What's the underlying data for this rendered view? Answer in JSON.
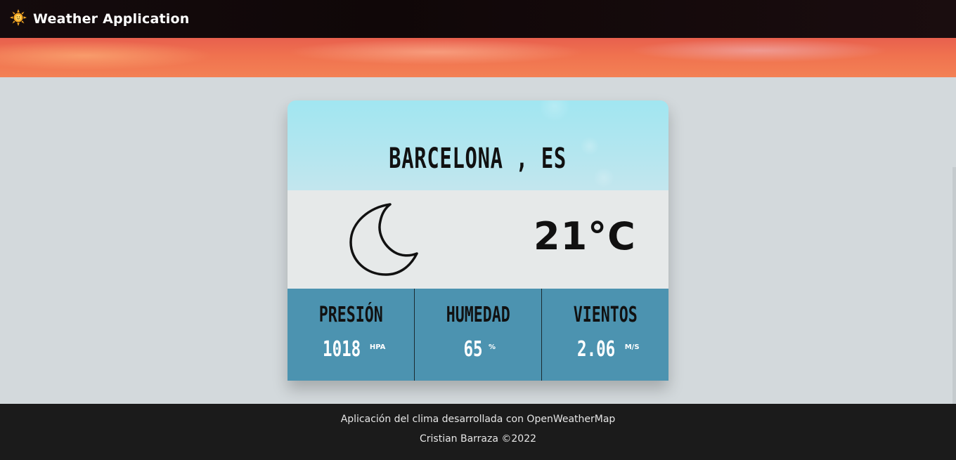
{
  "navbar": {
    "title": "Weather Application",
    "logo_icon": "sun-icon"
  },
  "weather": {
    "city": "BARCELONA , ES",
    "temperature": "21°C",
    "condition_icon": "moon-icon",
    "stats": [
      {
        "label": "PRESIÓN",
        "value": "1018",
        "unit": "HPA"
      },
      {
        "label": "HUMEDAD",
        "value": "65",
        "unit": "%"
      },
      {
        "label": "VIENTOS",
        "value": "2.06",
        "unit": "M/S"
      }
    ]
  },
  "footer": {
    "line1": "Aplicación del clima desarrollada con OpenWeatherMap",
    "line2": "Cristian Barraza ©2022"
  },
  "colors": {
    "stats_bg": "#4c93b0",
    "footer_bg": "#1b1b1b",
    "page_bg": "#d3d9dc"
  }
}
